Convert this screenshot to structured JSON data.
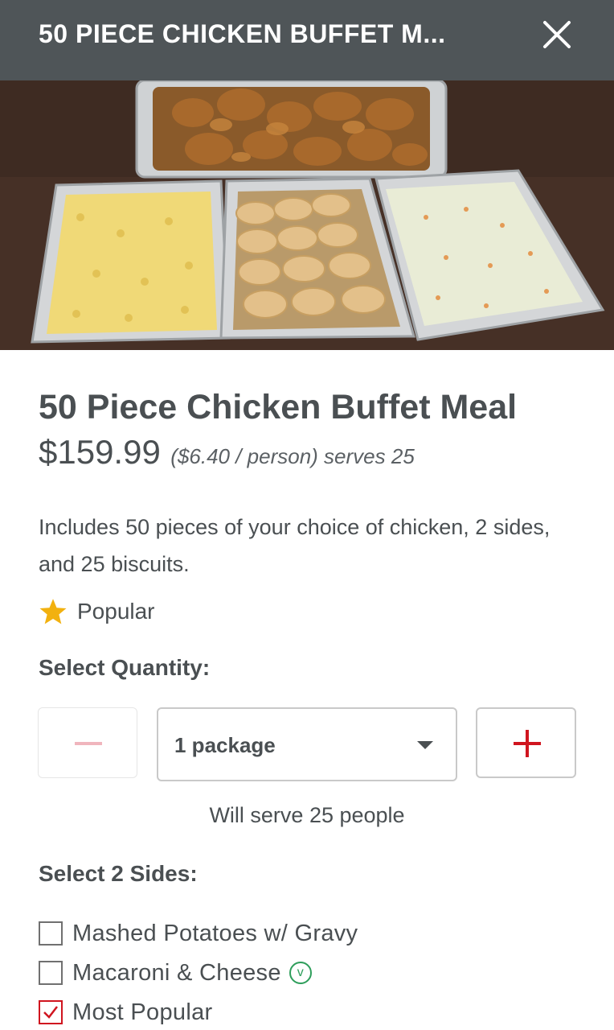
{
  "header": {
    "title": "50 PIECE CHICKEN BUFFET M..."
  },
  "item": {
    "name": "50 Piece Chicken Buffet Meal",
    "price": "$159.99",
    "price_note": "($6.40 / person) serves 25",
    "description": "Includes 50 pieces of your choice of chicken, 2 sides, and 25 biscuits.",
    "badge": "Popular"
  },
  "quantity": {
    "label": "Select Quantity:",
    "selected": "1 package",
    "serve_note": "Will serve 25 people"
  },
  "sides": {
    "label": "Select 2 Sides:",
    "options": [
      {
        "label": "Mashed Potatoes w/ Gravy",
        "checked": false
      },
      {
        "label": "Macaroni & Cheese",
        "checked": false,
        "icon": "vegetarian-icon",
        "icon_text": "v"
      },
      {
        "label": "Most Popular",
        "checked": true
      }
    ]
  },
  "colors": {
    "header_bg": "#4f5558",
    "accent_red": "#d0151f",
    "star": "#f2b10f",
    "veg_green": "#2e9e5b"
  }
}
